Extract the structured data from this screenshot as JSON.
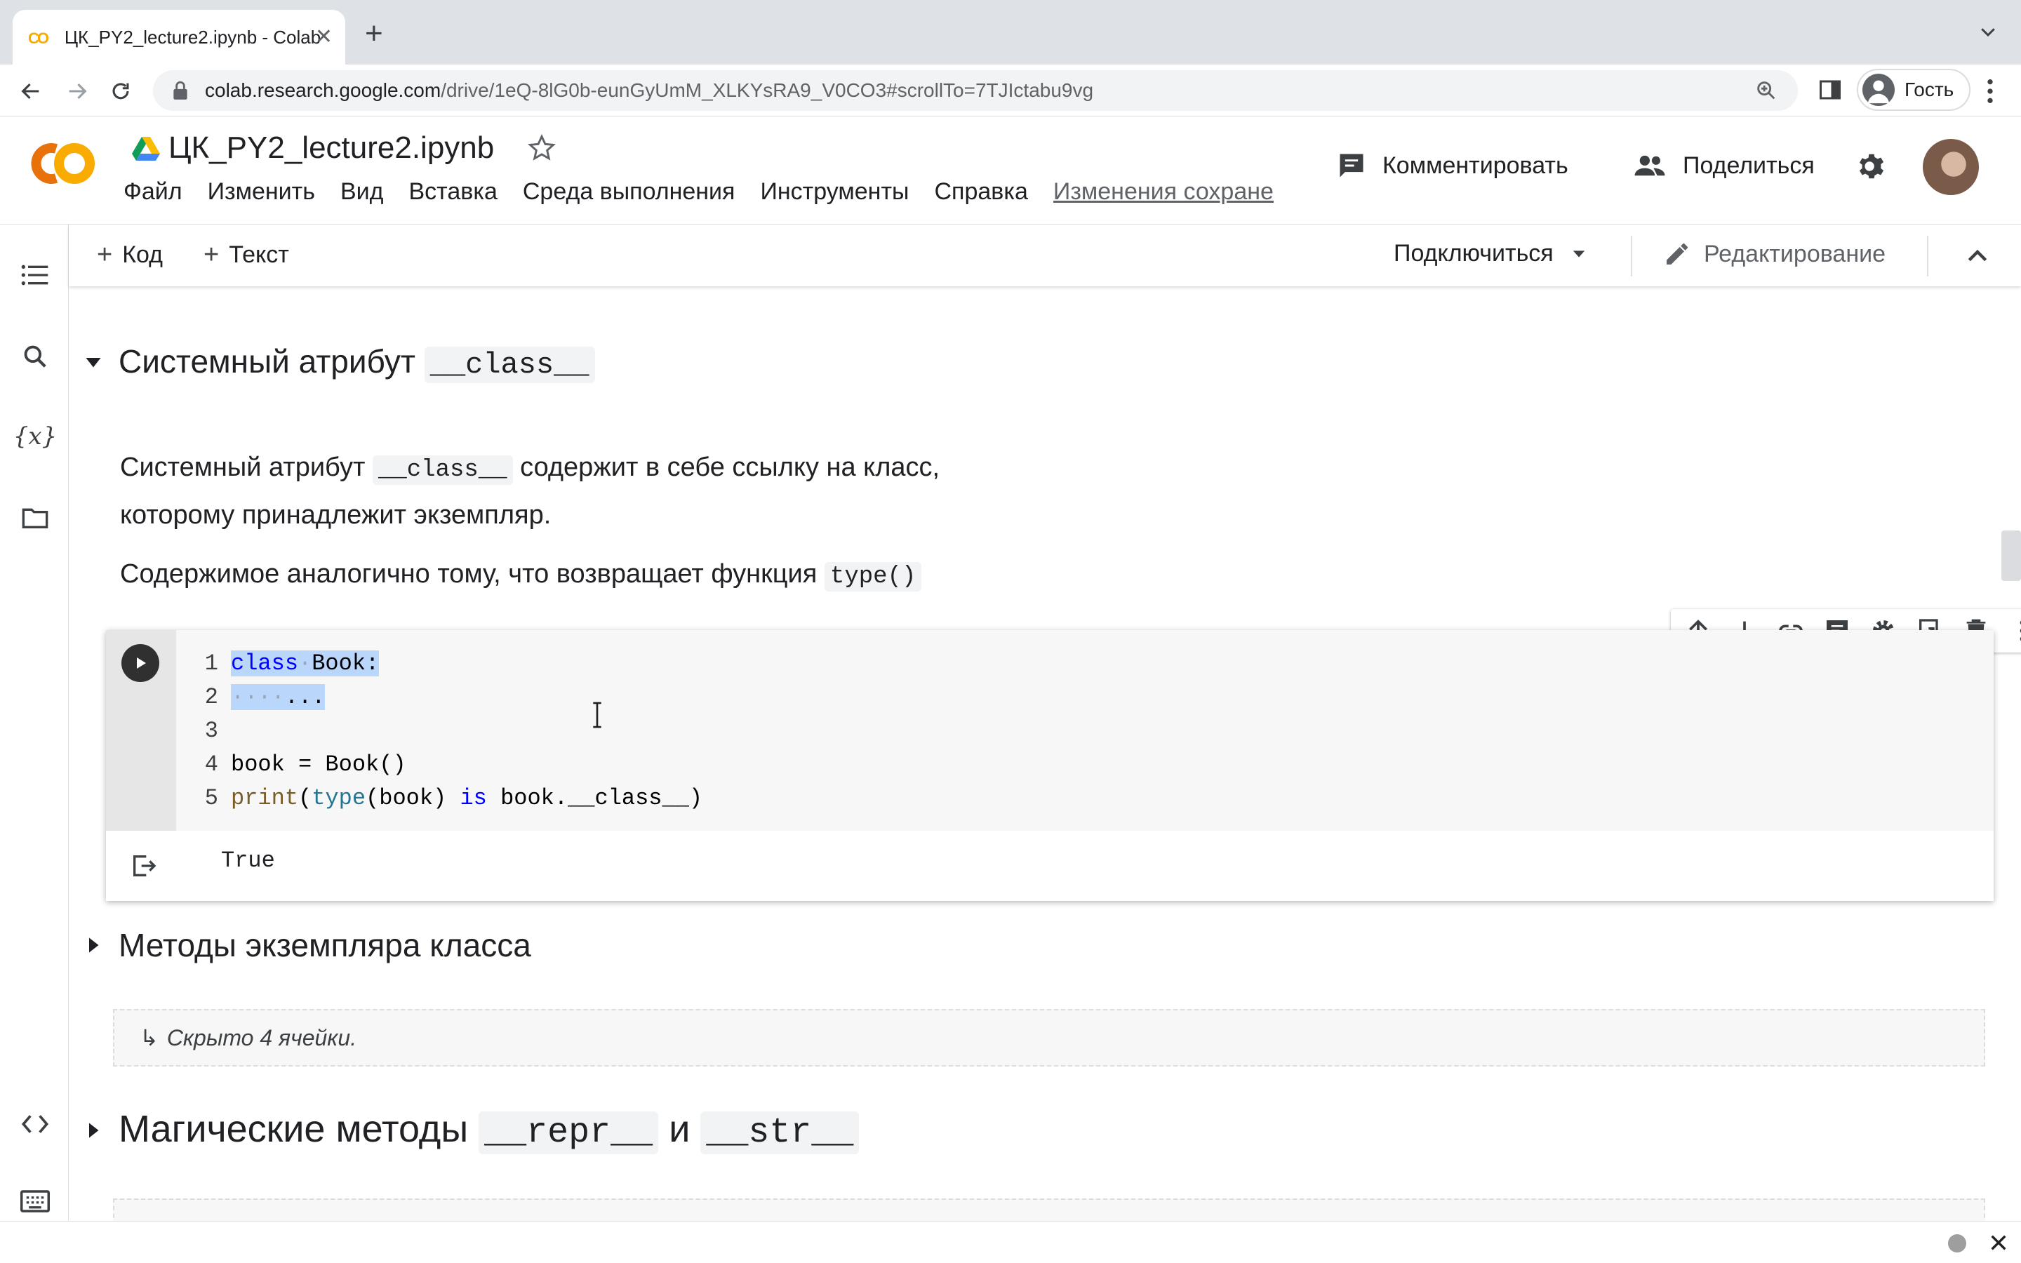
{
  "browser": {
    "tab_title": "ЦК_PY2_lecture2.ipynb - Colab",
    "favicon_text": "CO",
    "url_host": "colab.research.google.com",
    "url_path": "/drive/1eQ-8lG0b-eunGyUmM_XLKYsRA9_V0CO3#scrollTo=7TJIctabu9vg",
    "profile_label": "Гость"
  },
  "colab": {
    "doc_title": "ЦК_PY2_lecture2.ipynb",
    "menu": [
      "Файл",
      "Изменить",
      "Вид",
      "Вставка",
      "Среда выполнения",
      "Инструменты",
      "Справка"
    ],
    "changes_link": "Изменения сохранены",
    "comment_label": "Комментировать",
    "share_label": "Поделиться"
  },
  "toolbar": {
    "add_code": "Код",
    "add_text": "Текст",
    "connect": "Подключиться",
    "editing": "Редактирование"
  },
  "notebook": {
    "section1": {
      "title_prefix": "Системный атрибут ",
      "title_code": "__class__"
    },
    "text1": {
      "p1_prefix": "Системный атрибут ",
      "p1_code": "__class__",
      "p1_suffix": " содержит в себе ссылку на класс,",
      "p1_line2": "которому принадлежит экземпляр.",
      "p2_prefix": "Содержимое аналогично тому, что возвращает функция ",
      "p2_code": "type()"
    },
    "code_cell": {
      "line_numbers": [
        "1",
        "2",
        "3",
        "4",
        "5"
      ],
      "l1_kw": "class",
      "l1_rest": "Book:",
      "l2_rest": "...",
      "l4": "book = Book()",
      "l5_print": "print",
      "l5_type": "type",
      "l5_mid": "(book) ",
      "l5_is": "is",
      "l5_end": " book.__class__)",
      "output": "True"
    },
    "section2": {
      "title": "Методы экземпляра класса"
    },
    "hidden_cells": "Скрыто 4 ячейки.",
    "section3": {
      "title_prefix": "Магические методы ",
      "code_a": "__repr__",
      "mid": " и ",
      "code_b": "__str__"
    }
  },
  "colors": {
    "colab_orange": "#f9ab00",
    "selection": "#bbd6fb",
    "keyword": "#0000ff"
  }
}
